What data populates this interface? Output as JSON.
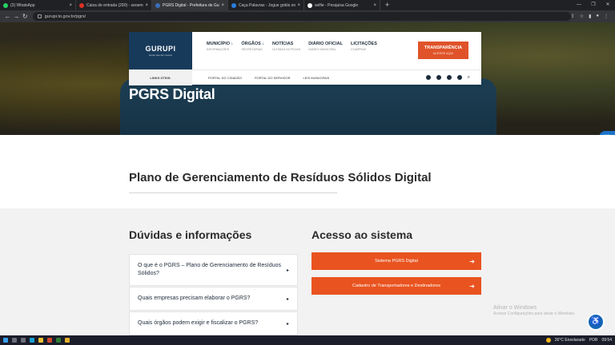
{
  "browser": {
    "tabs": [
      {
        "title": "(3) WhatsApp",
        "favicon_color": "#25d366",
        "active": false
      },
      {
        "title": "Caixa de entrada (290) - seoemp",
        "favicon_color": "#d93025",
        "active": false
      },
      {
        "title": "PGRS Digital - Prefeitura de Gur",
        "favicon_color": "#3b6fb6",
        "active": true
      },
      {
        "title": "Caça Palavras - Jogue grátis onli",
        "favicon_color": "#2a7de1",
        "active": false
      },
      {
        "title": "selfie - Pesquisa Google",
        "favicon_color": "#ffffff",
        "active": false
      }
    ],
    "new_tab": "+",
    "url": "gurupi.to.gov.br/pgrs/"
  },
  "header": {
    "logo_text": "GURUPI",
    "logo_subtitle": "Gente que faz crescer",
    "menu": [
      {
        "label": "MUNICÍPIO ↓",
        "sub": "INFORMAÇÕES"
      },
      {
        "label": "ÓRGÃOS ↓",
        "sub": "SECRETARIAS"
      },
      {
        "label": "NOTÍCIAS",
        "sub": "ÚLTIMAS NOTÍCIAS"
      },
      {
        "label": "DIÁRIO OFICIAL",
        "sub": "DIÁRIO MUNICIPAL"
      },
      {
        "label": "LICITAÇÕES",
        "sub": "COMPRAS"
      }
    ],
    "transparency": {
      "label": "TRANSPARÊNCIA",
      "sub": "ACESSE AQUI"
    },
    "links_label": "LINKS ÚTEIS:",
    "links": [
      "PORTAL DO CIDADÃO",
      "PORTAL DO SERVIDOR",
      "LEIS MUNICIPAIS"
    ]
  },
  "hero": {
    "title": "PGRS Digital"
  },
  "main": {
    "heading": "Plano de Gerenciamento de Resíduos Sólidos Digital",
    "faq_title": "Dúvidas e informações",
    "faq": [
      "O que é o PGRS – Plano de Gerenciamento de Resíduos Sólidos?",
      "Quais empresas precisam elaborar o PGRS?",
      "Quais órgãos podem exigir e fiscalizar o PGRS?"
    ],
    "access_title": "Acesso ao sistema",
    "buttons": [
      "Sistema PGRS Digital",
      "Cadastro de Transportadores e Destinadores"
    ]
  },
  "watermark": {
    "line1": "Ativar o Windows",
    "line2": "Acesse Configurações para ativar o Windows."
  },
  "taskbar": {
    "weather": "26°C  Ensolarado",
    "lang": "POR",
    "time": "09:54"
  },
  "colors": {
    "accent": "#e9531f",
    "navy": "#183a5a"
  }
}
